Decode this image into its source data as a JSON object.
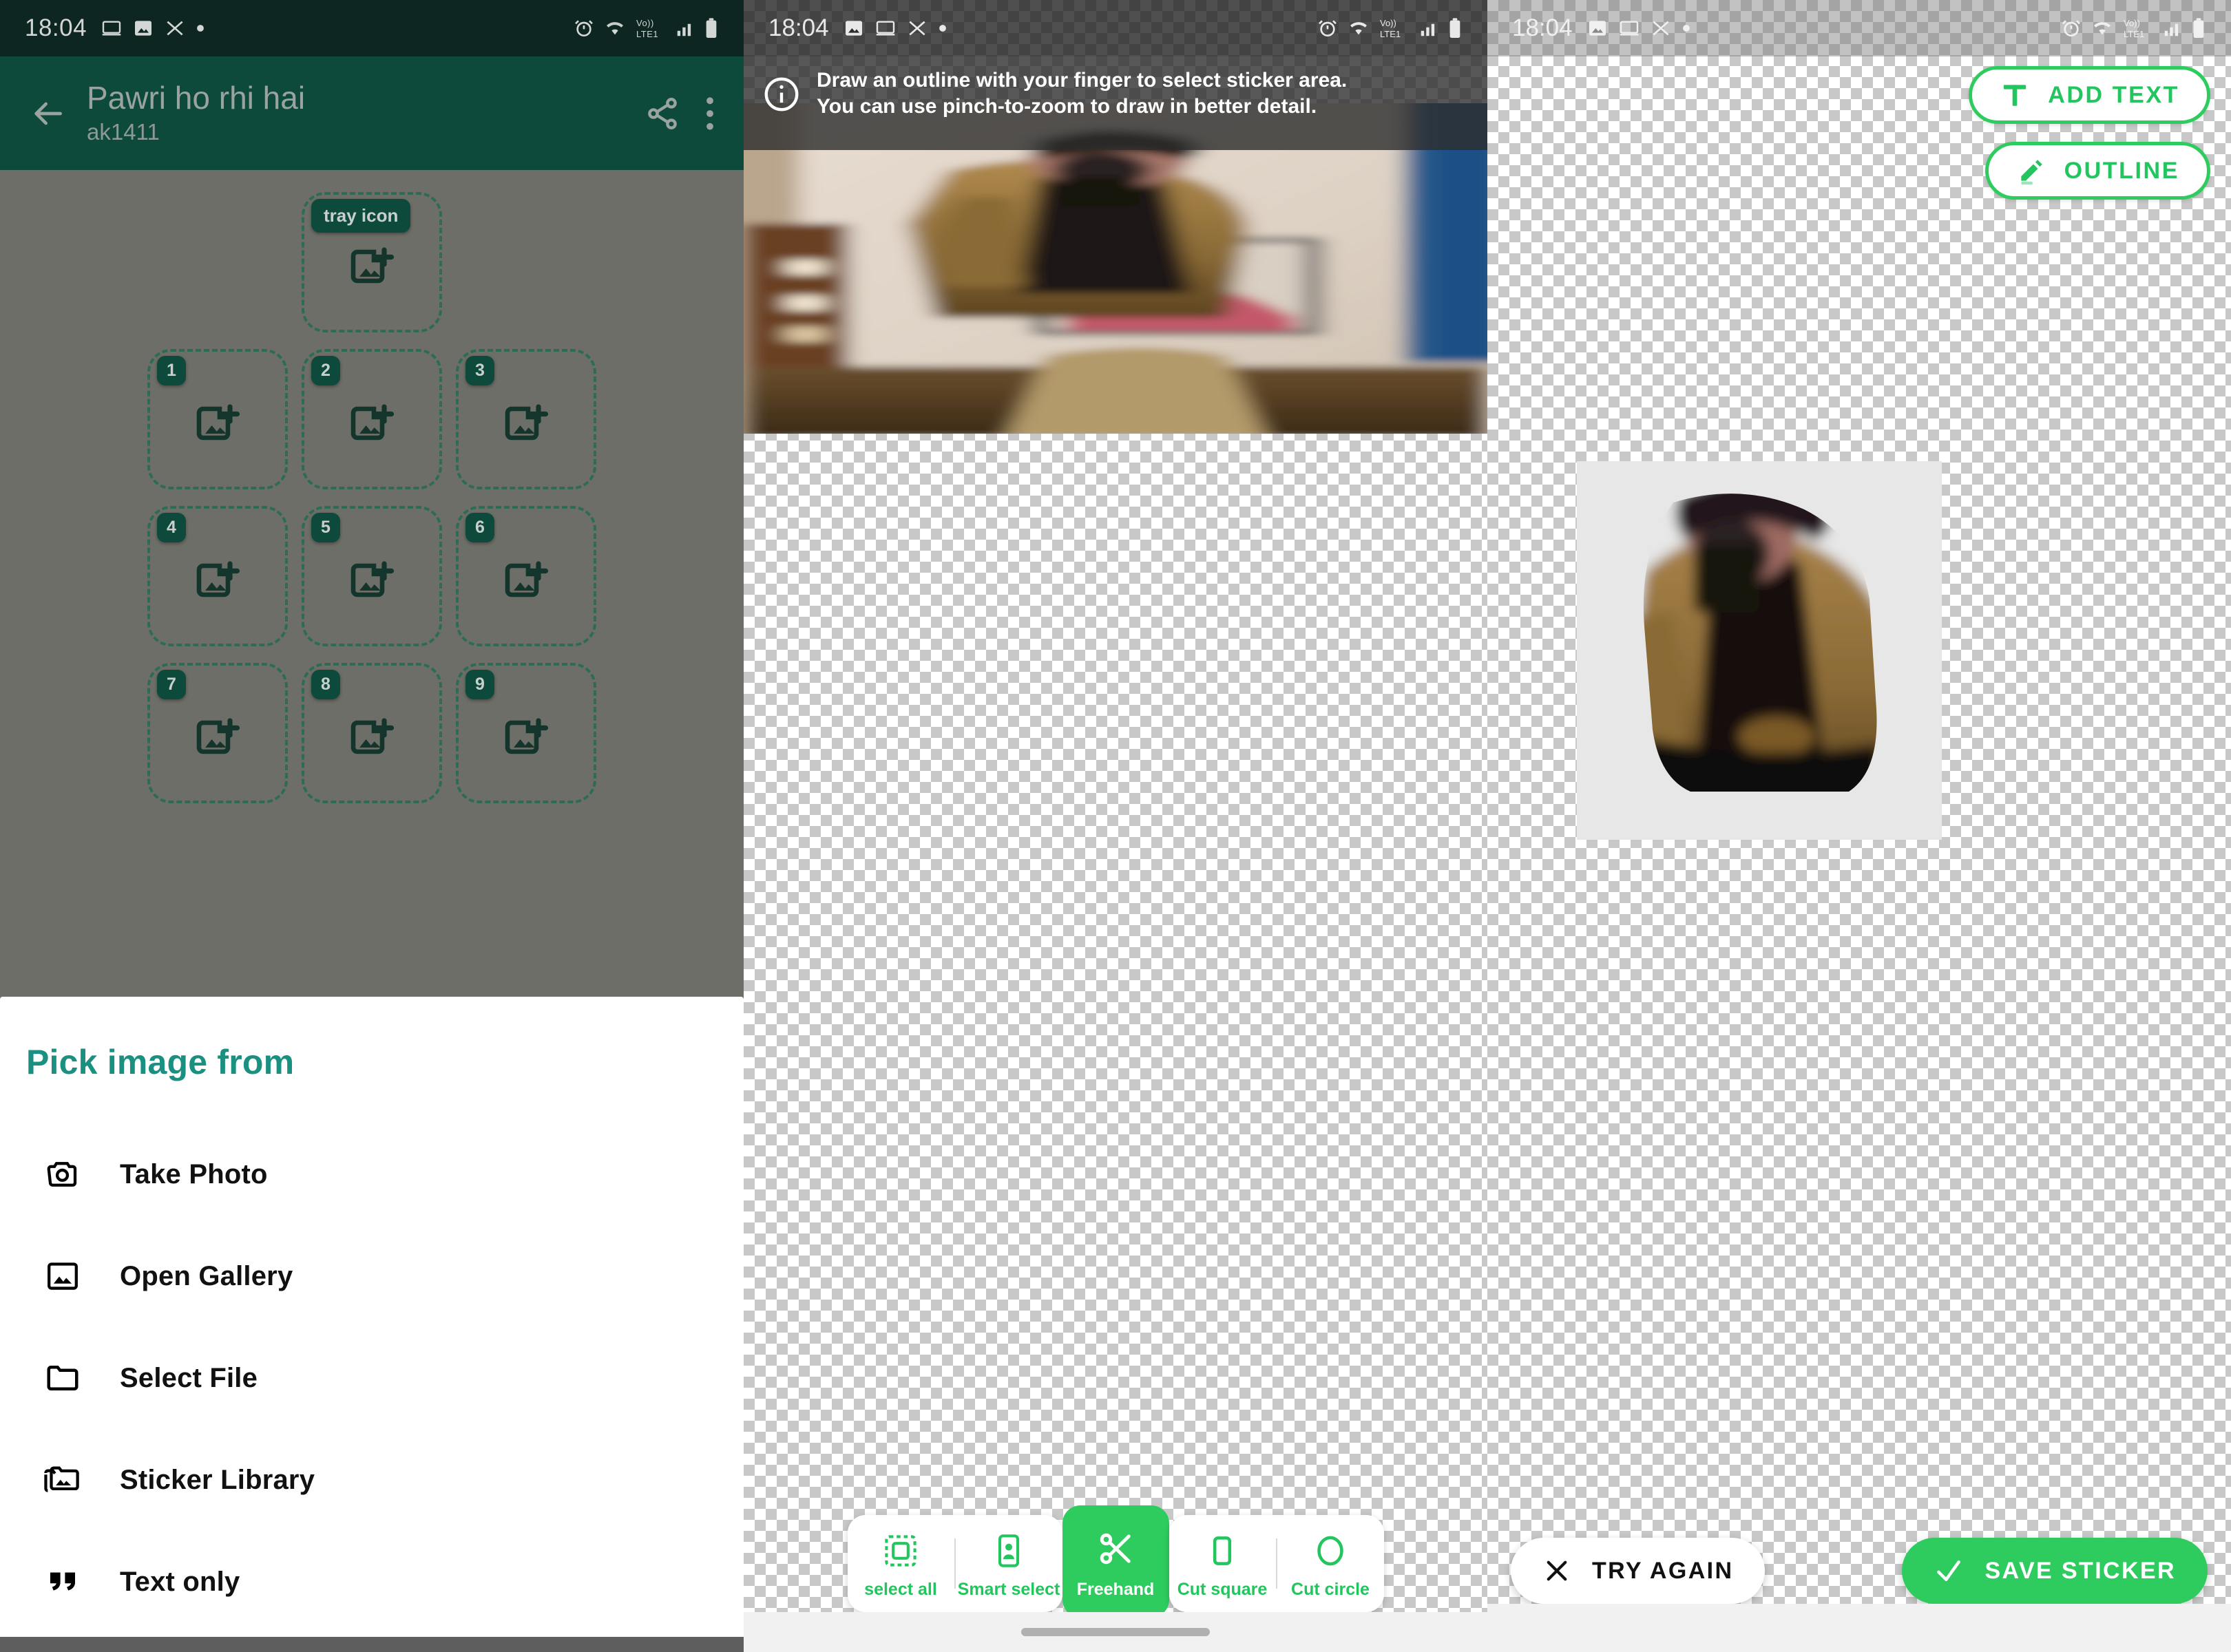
{
  "status_bar": {
    "time": "18:04",
    "left_icons": [
      "desktop-icon",
      "image-icon",
      "shuffle-icon",
      "dot-icon"
    ],
    "right_icons": [
      "alarm-icon",
      "wifi-icon",
      "volte-icon",
      "signal-icon",
      "battery-icon"
    ],
    "network_label": "Vo)) LTE1"
  },
  "panel_tray": {
    "app_bar": {
      "back_icon": "arrow-back-icon",
      "title": "Pawri ho rhi hai",
      "subtitle": "ak1411",
      "share_icon": "share-icon",
      "overflow_icon": "more-vertical-icon"
    },
    "tray_cell": {
      "label": "tray icon",
      "add_icon": "add-image-icon"
    },
    "sticker_cells": [
      {
        "label": "1"
      },
      {
        "label": "2"
      },
      {
        "label": "3"
      },
      {
        "label": "4"
      },
      {
        "label": "5"
      },
      {
        "label": "6"
      },
      {
        "label": "7"
      },
      {
        "label": "8"
      },
      {
        "label": "9"
      }
    ],
    "sheet": {
      "title": "Pick image from",
      "items": [
        {
          "icon": "camera-icon",
          "label": "Take Photo"
        },
        {
          "icon": "image-icon",
          "label": "Open Gallery"
        },
        {
          "icon": "folder-icon",
          "label": "Select File"
        },
        {
          "icon": "folder-image-icon",
          "label": "Sticker Library"
        },
        {
          "icon": "quote-icon",
          "label": "Text only"
        }
      ]
    }
  },
  "panel_cutout": {
    "banner": {
      "icon": "info-icon",
      "line1": "Draw an outline with your finger to select sticker area.",
      "line2": "You can use pinch-to-zoom to draw in better detail."
    },
    "tools_left": [
      {
        "icon": "select-all-icon",
        "label": "select all",
        "active": false
      },
      {
        "icon": "smart-select-icon",
        "label": "Smart select",
        "active": false
      }
    ],
    "tool_active": {
      "icon": "scissors-icon",
      "label": "Freehand",
      "active": true
    },
    "tools_right": [
      {
        "icon": "square-icon",
        "label": "Cut square",
        "active": false
      },
      {
        "icon": "circle-icon",
        "label": "Cut circle",
        "active": false
      }
    ]
  },
  "panel_preview": {
    "add_text_button": {
      "icon": "text-format-icon",
      "label": "ADD TEXT"
    },
    "outline_button": {
      "icon": "pencil-icon",
      "label": "OUTLINE"
    },
    "try_again_button": {
      "icon": "close-icon",
      "label": "TRY AGAIN"
    },
    "save_sticker_button": {
      "icon": "check-icon",
      "label": "SAVE STICKER"
    }
  },
  "colors": {
    "brand_teal": "#1a9080",
    "app_bar_green": "#0d4a3c",
    "status_bar_dark": "#0d2621",
    "accent_green": "#2ecc5f",
    "tool_green": "#22c55e",
    "dashed_border": "#2e6b55",
    "scrim_grey": "#6e6e68"
  }
}
